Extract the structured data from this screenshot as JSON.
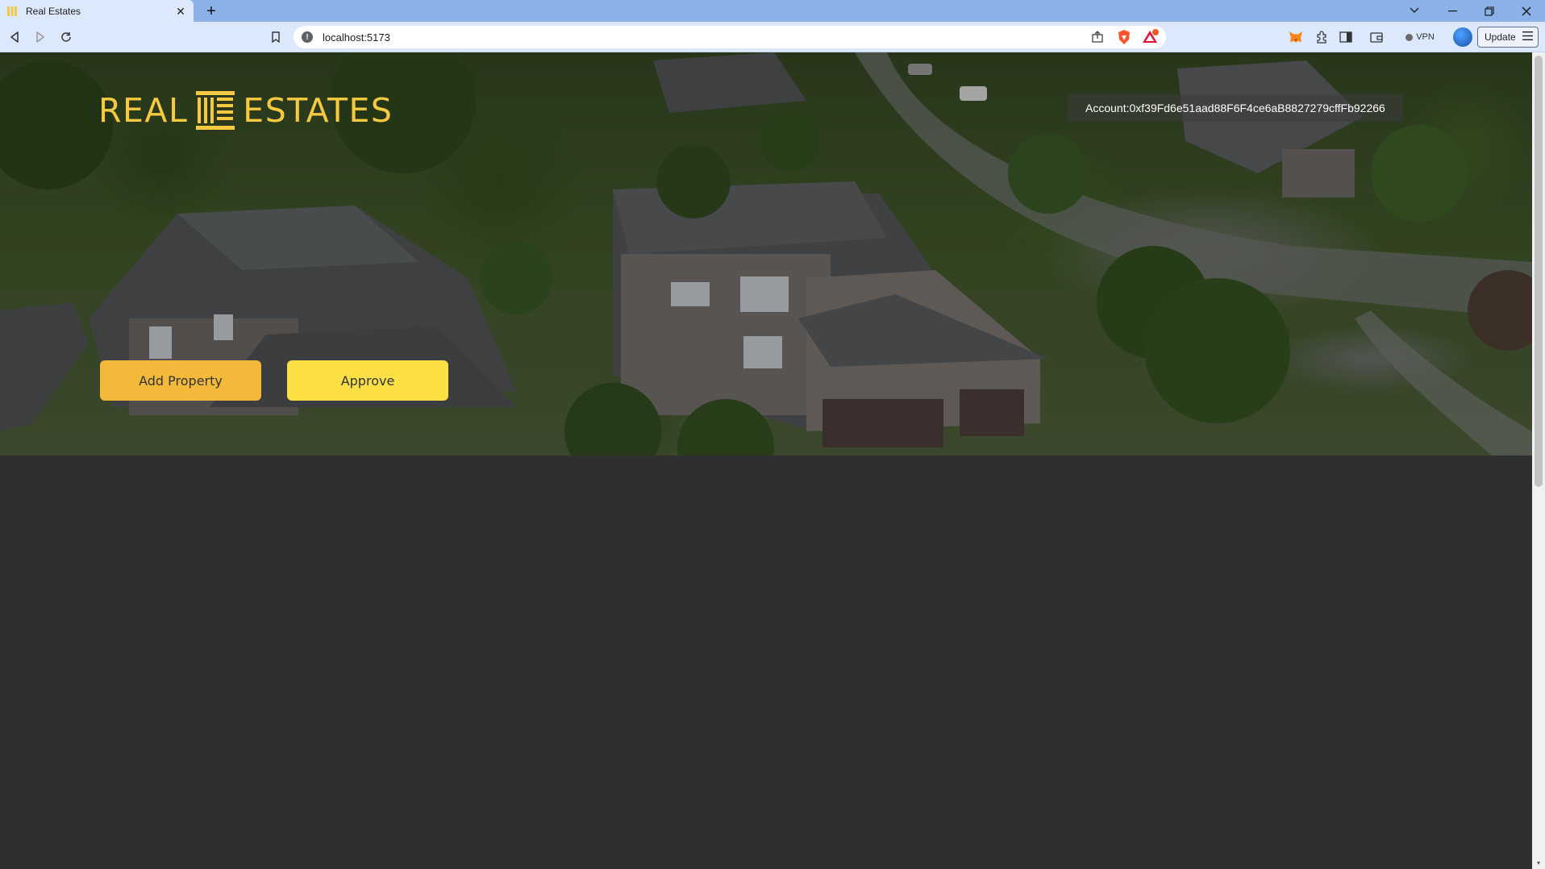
{
  "browser": {
    "tab_title": "Real Estates",
    "url": "localhost:5173",
    "vpn_label": "VPN",
    "update_label": "Update"
  },
  "page": {
    "logo_left": "REAL",
    "logo_right": "ESTATES",
    "account_text": "Account:0xf39Fd6e51aad88F6F4ce6aB8827279cffFb92266",
    "add_property_label": "Add Property",
    "approve_label": "Approve"
  },
  "colors": {
    "accent_gold": "#f6c940",
    "add_button": "#f4b93a",
    "approve_button": "#fbdf45",
    "page_background": "#2f2f2f"
  }
}
